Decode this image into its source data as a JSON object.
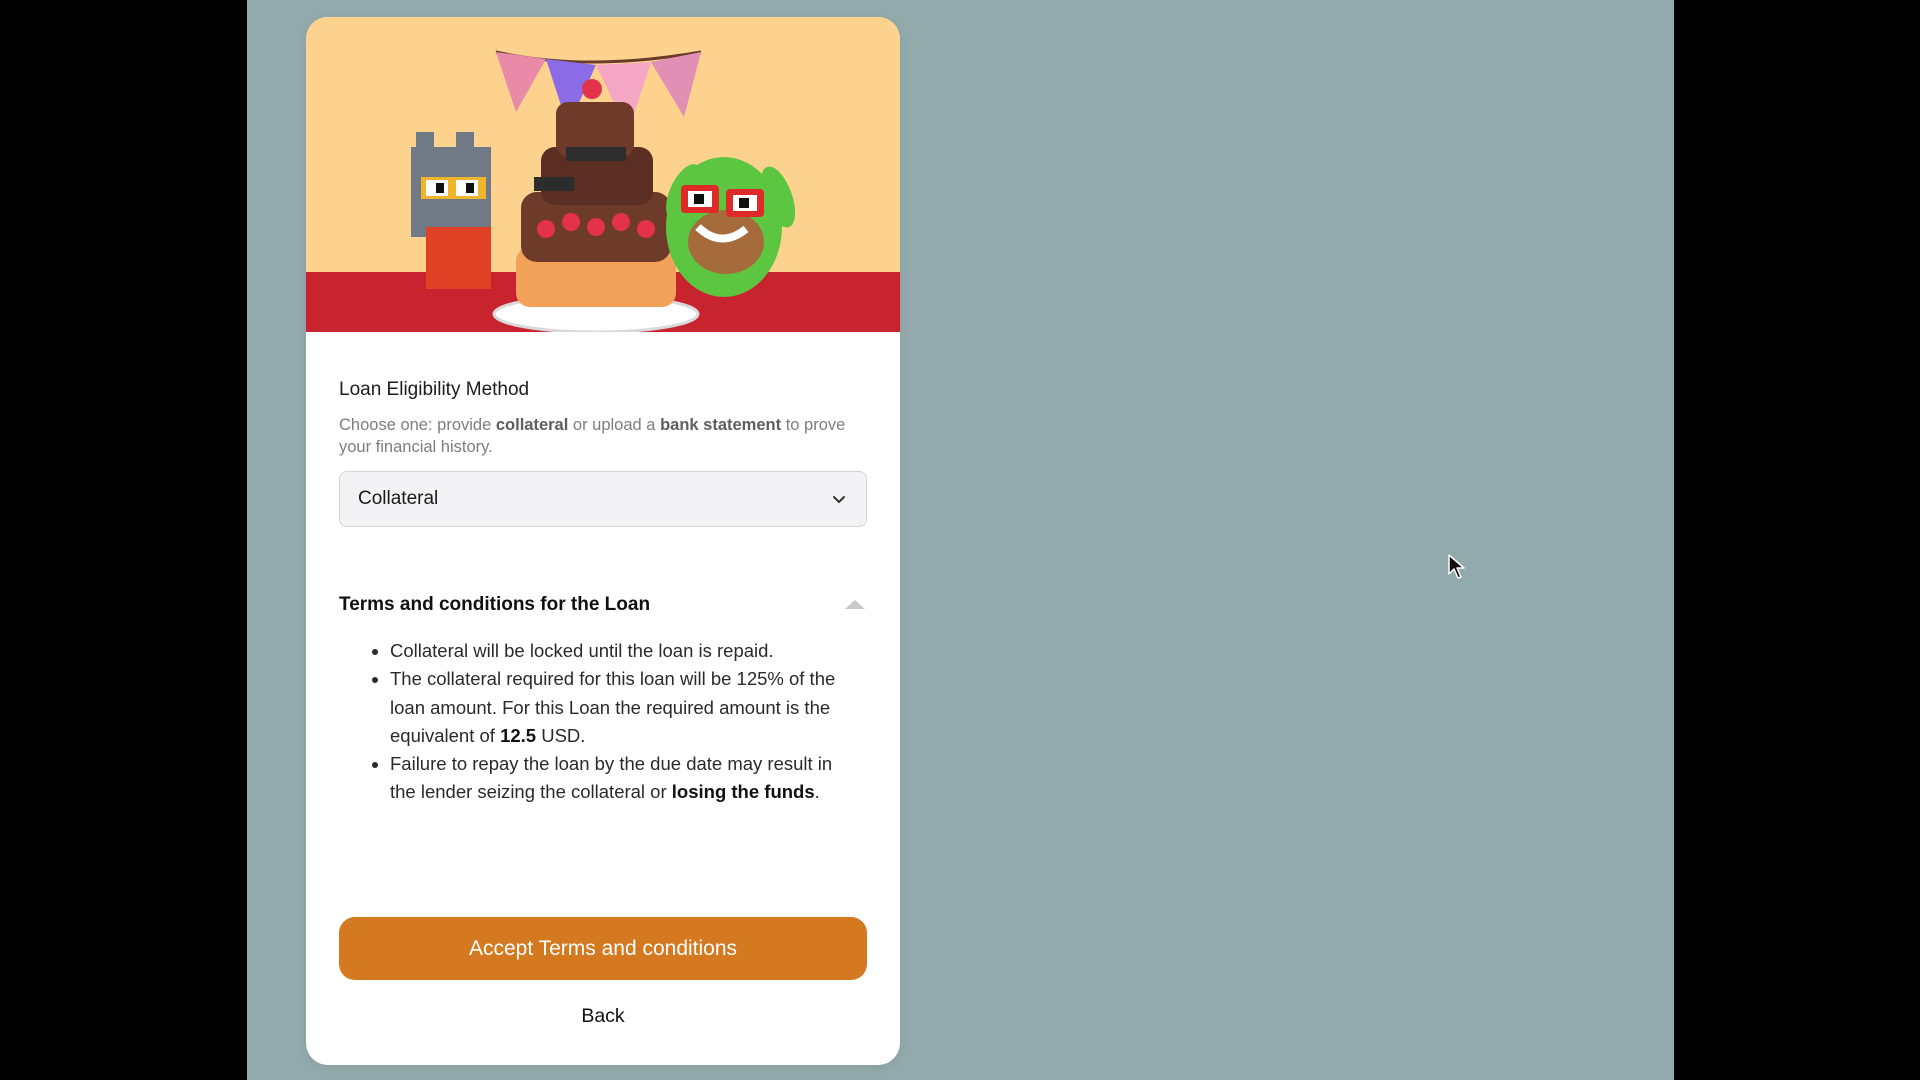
{
  "form": {
    "label": "Loan Eligibility Method",
    "helper_parts": {
      "p1": "Choose one: provide ",
      "b1": "collateral",
      "p2": " or upload a ",
      "b2": "bank statement",
      "p3": " to prove your financial history."
    },
    "select_value": "Collateral"
  },
  "terms": {
    "title": "Terms and conditions for the Loan",
    "item1": "Collateral will be locked until the loan is repaid.",
    "item2_a": "The collateral required for this loan will be 125% of the loan amount. For this Loan the required amount is the equivalent of ",
    "item2_b": "12.5",
    "item2_c": " USD.",
    "item3_a": "Failure to repay the loan by the due date may result in the lender seizing the collateral or ",
    "item3_b": "losing the funds",
    "item3_c": "."
  },
  "actions": {
    "accept_label": "Accept Terms and conditions",
    "back_label": "Back"
  },
  "colors": {
    "background": "#93aaad",
    "accent": "#d4791f",
    "hero_top": "#fcd28e",
    "hero_bottom": "#c7242f"
  },
  "icons": {
    "select_chevron": "chevron-down-icon",
    "collapse": "caret-up-icon",
    "cursor": "mouse-pointer-icon"
  }
}
